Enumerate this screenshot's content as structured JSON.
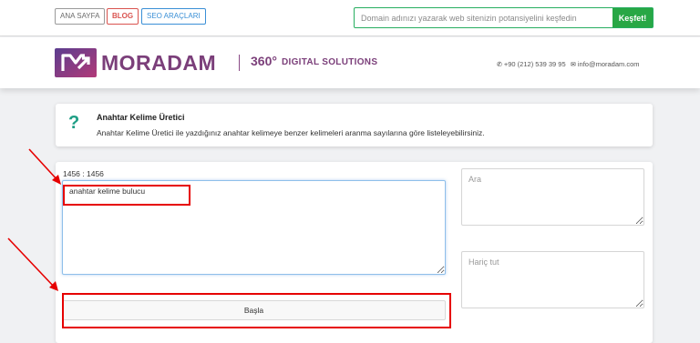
{
  "nav": {
    "home": "ANA SAYFA",
    "blog": "BLOG",
    "seo_tools": "SEO ARAÇLARI"
  },
  "search": {
    "placeholder": "Domain adınızı yazarak web sitenizin potansiyelini keşfedin",
    "button": "Keşfet!"
  },
  "header": {
    "logo_text": "MORADAM",
    "tagline_number": "360°",
    "tagline_text": "DIGITAL SOLUTIONS",
    "phone": "+90 (212) 539 39 95",
    "email": "info@moradam.com",
    "phone_icon": "phone-icon",
    "email_icon": "envelope-icon"
  },
  "info": {
    "icon": "?",
    "title": "Anahtar Kelime Üretici",
    "description": "Anahtar Kelime Üretici ile yazdığınız anahtar kelimeye benzer kelimeleri aranma sayılarına göre listeleyebilirsiniz."
  },
  "tool": {
    "counter": "1456 : 1456",
    "keyword_value": "anahtar kelime bulucu",
    "start_button": "Başla",
    "search_placeholder": "Ara",
    "exclude_placeholder": "Hariç tut"
  },
  "colors": {
    "brand_purple": "#7b3f7a",
    "accent_green": "#28a745",
    "annotation_red": "#e60000"
  }
}
